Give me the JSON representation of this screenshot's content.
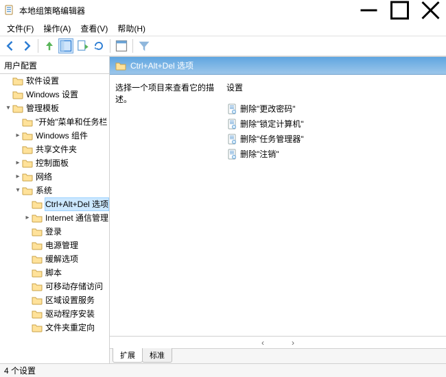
{
  "window": {
    "title": "本地组策略编辑器"
  },
  "menus": {
    "file": "文件(F)",
    "action": "操作(A)",
    "view": "查看(V)",
    "help": "帮助(H)"
  },
  "tree": {
    "root": "用户配置",
    "nodes": [
      {
        "indent": 1,
        "caret": "empty",
        "icon": "folder",
        "label": "软件设置"
      },
      {
        "indent": 1,
        "caret": "empty",
        "icon": "folder",
        "label": "Windows 设置"
      },
      {
        "indent": 1,
        "caret": "down",
        "icon": "folder",
        "label": "管理模板"
      },
      {
        "indent": 2,
        "caret": "empty",
        "icon": "folder",
        "label": "\"开始\"菜单和任务栏"
      },
      {
        "indent": 2,
        "caret": "right",
        "icon": "folder",
        "label": "Windows 组件"
      },
      {
        "indent": 2,
        "caret": "empty",
        "icon": "folder",
        "label": "共享文件夹"
      },
      {
        "indent": 2,
        "caret": "right",
        "icon": "folder",
        "label": "控制面板"
      },
      {
        "indent": 2,
        "caret": "right",
        "icon": "folder",
        "label": "网络"
      },
      {
        "indent": 2,
        "caret": "down",
        "icon": "folder",
        "label": "系统"
      },
      {
        "indent": 3,
        "caret": "empty",
        "icon": "folder",
        "label": "Ctrl+Alt+Del 选项",
        "selected": true
      },
      {
        "indent": 3,
        "caret": "right",
        "icon": "folder",
        "label": "Internet 通信管理"
      },
      {
        "indent": 3,
        "caret": "empty",
        "icon": "folder",
        "label": "登录"
      },
      {
        "indent": 3,
        "caret": "empty",
        "icon": "folder",
        "label": "电源管理"
      },
      {
        "indent": 3,
        "caret": "empty",
        "icon": "folder",
        "label": "缓解选项"
      },
      {
        "indent": 3,
        "caret": "empty",
        "icon": "folder",
        "label": "脚本"
      },
      {
        "indent": 3,
        "caret": "empty",
        "icon": "folder",
        "label": "可移动存储访问"
      },
      {
        "indent": 3,
        "caret": "empty",
        "icon": "folder",
        "label": "区域设置服务"
      },
      {
        "indent": 3,
        "caret": "empty",
        "icon": "folder",
        "label": "驱动程序安装"
      },
      {
        "indent": 3,
        "caret": "empty",
        "icon": "folder",
        "label": "文件夹重定向"
      }
    ]
  },
  "details": {
    "header": "Ctrl+Alt+Del 选项",
    "description": "选择一个项目来查看它的描述。",
    "column": "设置",
    "items": [
      "删除\"更改密码\"",
      "删除\"锁定计算机\"",
      "删除\"任务管理器\"",
      "删除\"注销\""
    ],
    "tabs": {
      "extended": "扩展",
      "standard": "标准"
    }
  },
  "status": "4 个设置"
}
